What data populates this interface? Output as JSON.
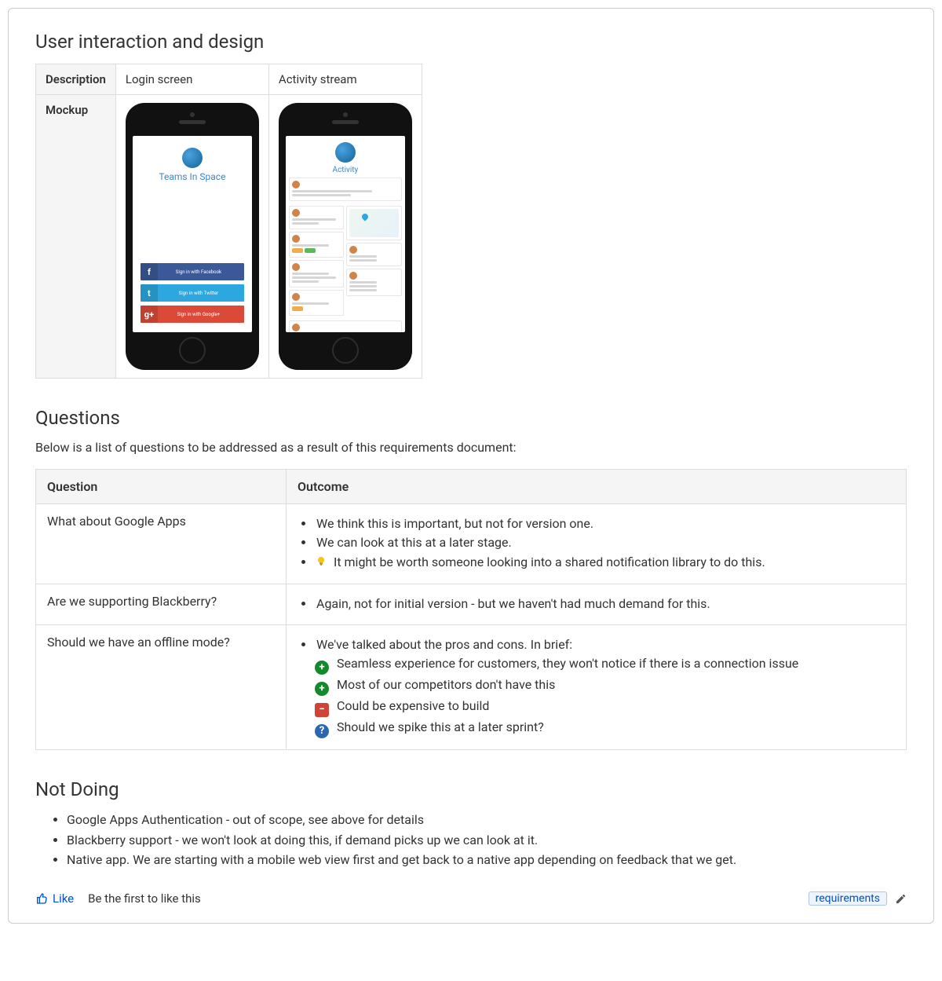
{
  "sections": {
    "design_heading": "User interaction and design",
    "questions_heading": "Questions",
    "questions_intro": "Below is a list of questions to be addressed as a result of this requirements document:",
    "notdoing_heading": "Not Doing"
  },
  "mockup_table": {
    "row_labels": {
      "description": "Description",
      "mockup": "Mockup"
    },
    "cols": [
      {
        "title": "Login screen"
      },
      {
        "title": "Activity stream"
      }
    ]
  },
  "mockup_login": {
    "brand": "Teams In Space",
    "facebook": "Sign in with Facebook",
    "twitter": "Sign in with Twitter",
    "google": "Sign in with Google+"
  },
  "mockup_activity": {
    "title": "Activity"
  },
  "questions_table": {
    "headers": {
      "q": "Question",
      "o": "Outcome"
    },
    "rows": [
      {
        "q": "What about Google Apps",
        "o": [
          {
            "t": "We think this is important, but not for version one."
          },
          {
            "t": "We can look at this at a later stage."
          },
          {
            "icon": "bulb",
            "t": "It might be worth someone looking into a shared notification library to do this."
          }
        ]
      },
      {
        "q": "Are we supporting Blackberry?",
        "o": [
          {
            "t": "Again, not for initial version - but we haven't had much demand for this."
          }
        ]
      },
      {
        "q": "Should we have an offline mode?",
        "o": [
          {
            "t": "We've talked about the pros and cons. In brief:"
          },
          {
            "sub": true,
            "icon": "plus",
            "t": "Seamless experience for customers, they won't notice if there is a connection issue"
          },
          {
            "sub": true,
            "icon": "plus",
            "t": "Most of our competitors don't have this"
          },
          {
            "sub": true,
            "icon": "minus",
            "t": "Could be expensive to build"
          },
          {
            "sub": true,
            "icon": "q",
            "t": "Should we spike this at a later sprint?"
          }
        ]
      }
    ]
  },
  "not_doing": [
    "Google Apps Authentication - out of scope, see above for details",
    "Blackberry support - we won't look at doing this, if demand picks up we can look at it.",
    "Native app. We are starting with a mobile web view first and get back to a native app depending on feedback that we get."
  ],
  "footer": {
    "like": "Like",
    "be_first": "Be the first to like this",
    "tag": "requirements"
  }
}
